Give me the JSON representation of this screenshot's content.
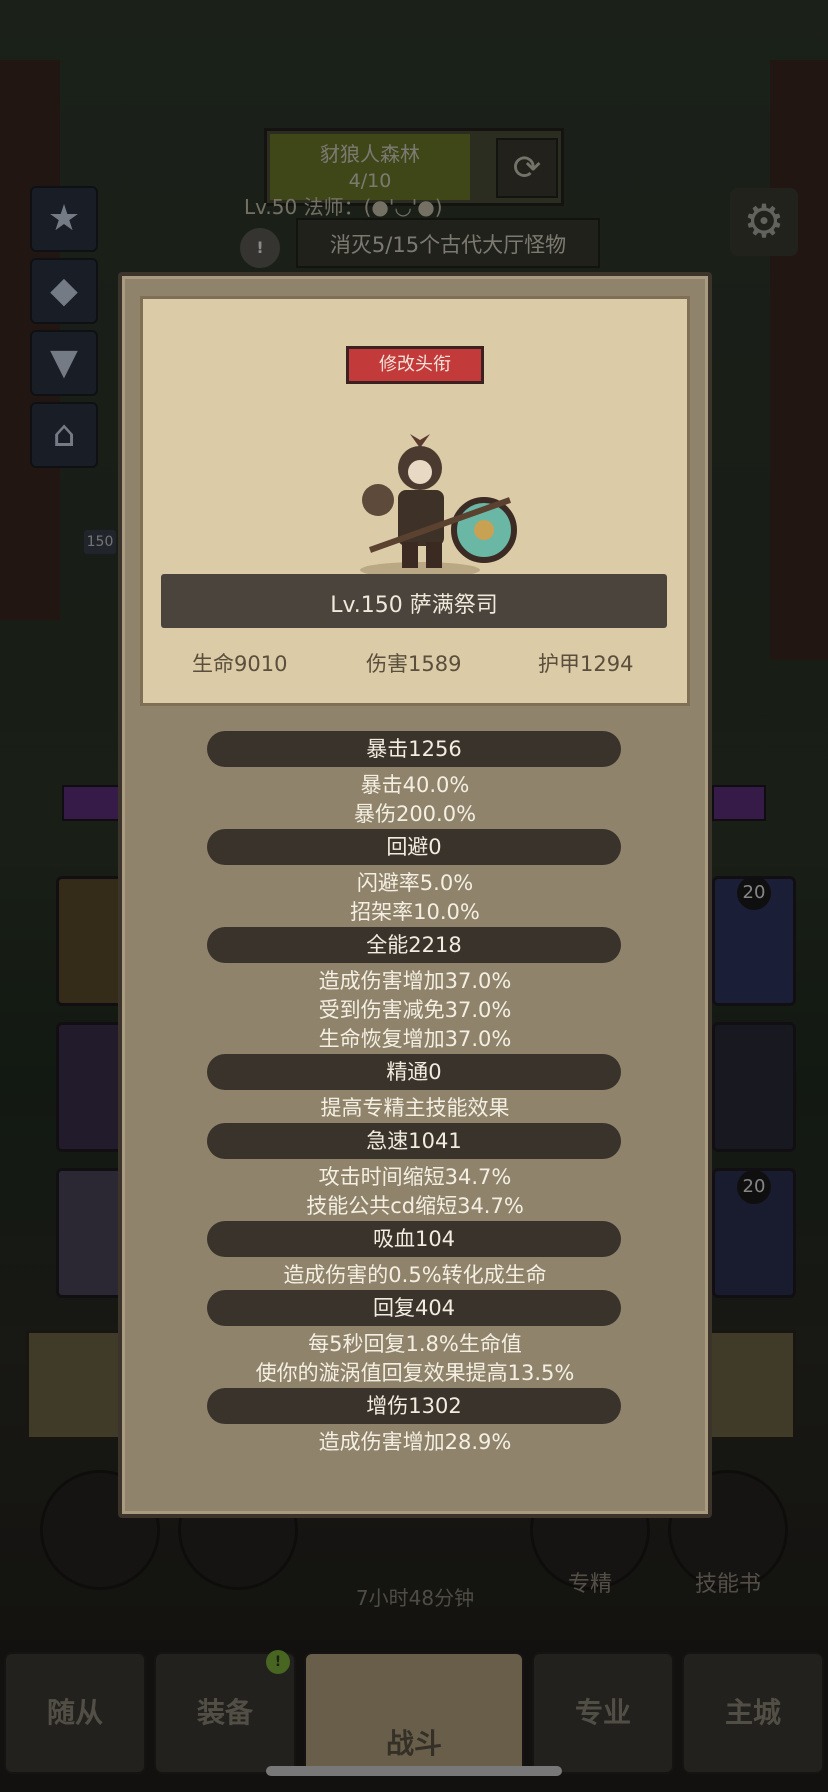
{
  "zone": {
    "name": "豺狼人森林",
    "progress": "4/10",
    "player": "Lv.50 法师：(●'◡'●)",
    "quest": "消灭5/15个古代大厅怪物",
    "side_level_tag": "150"
  },
  "background": {
    "slot_badges": [
      "20",
      "20"
    ],
    "timer": "7小时48分钟",
    "bottom_labels": [
      "专精",
      "技能书"
    ]
  },
  "nav": {
    "tabs": [
      "随从",
      "装备",
      "战斗",
      "专业",
      "主城"
    ],
    "active_tab": "战斗",
    "badge": "!"
  },
  "character": {
    "rename_button": "修改头衔",
    "name_line": "Lv.150 萨满祭司",
    "hp": "生命9010",
    "damage": "伤害1589",
    "armor": "护甲1294"
  },
  "stats": [
    {
      "header": "暴击1256",
      "lines": [
        "暴击40.0%",
        "暴伤200.0%"
      ]
    },
    {
      "header": "回避0",
      "lines": [
        "闪避率5.0%",
        "招架率10.0%"
      ]
    },
    {
      "header": "全能2218",
      "lines": [
        "造成伤害增加37.0%",
        "受到伤害减免37.0%",
        "生命恢复增加37.0%"
      ]
    },
    {
      "header": "精通0",
      "lines": [
        "提高专精主技能效果"
      ]
    },
    {
      "header": "急速1041",
      "lines": [
        "攻击时间缩短34.7%",
        "技能公共cd缩短34.7%"
      ]
    },
    {
      "header": "吸血104",
      "lines": [
        "造成伤害的0.5%转化成生命"
      ]
    },
    {
      "header": "回复404",
      "lines": [
        "每5秒回复1.8%生命值",
        "使你的漩涡值回复效果提高13.5%"
      ]
    },
    {
      "header": "增伤1302",
      "lines": [
        "造成伤害增加28.9%"
      ]
    }
  ],
  "colors": {
    "modal_bg": "#8f836b",
    "card_bg": "#dbcba7",
    "stat_header_bg": "#3a332b",
    "rename_button": "#c33a3a",
    "nav_active": "#b3a37f"
  }
}
